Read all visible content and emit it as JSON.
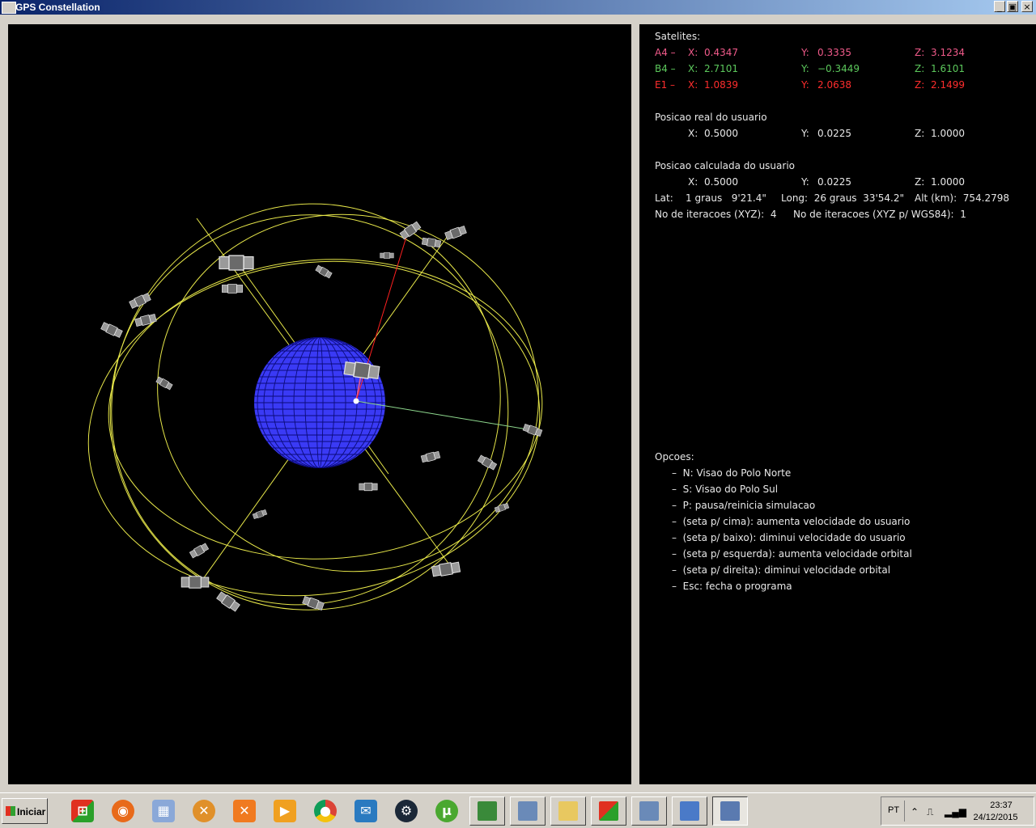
{
  "window": {
    "title": "GPS Constellation",
    "minimize": "_",
    "maximize": "▣",
    "close": "×"
  },
  "info": {
    "satellites_heading": "Satelites:",
    "satellites": [
      {
        "label": "A4 –",
        "x_label": "X:",
        "x": "0.4347",
        "y_label": "Y:",
        "y": "0.3335",
        "z_label": "Z:",
        "z": "3.1234",
        "color": "#f05a8a"
      },
      {
        "label": "B4 –",
        "x_label": "X:",
        "x": "2.7101",
        "y_label": "Y:",
        "y": "−0.3449",
        "z_label": "Z:",
        "z": "1.6101",
        "color": "#5cc85c"
      },
      {
        "label": "E1 –",
        "x_label": "X:",
        "x": "1.0839",
        "y_label": "Y:",
        "y": "2.0638",
        "z_label": "Z:",
        "z": "2.1499",
        "color": "#ff2d2d"
      }
    ],
    "real_heading": "Posicao real do usuario",
    "real": {
      "x_label": "X:",
      "x": "0.5000",
      "y_label": "Y:",
      "y": "0.0225",
      "z_label": "Z:",
      "z": "1.0000"
    },
    "calc_heading": "Posicao calculada do usuario",
    "calc": {
      "x_label": "X:",
      "x": "0.5000",
      "y_label": "Y:",
      "y": "0.0225",
      "z_label": "Z:",
      "z": "1.0000"
    },
    "lat": "Lat:    1 graus   9'21.4\"",
    "long": "Long:  26 graus  33'54.2\"",
    "alt": "Alt (km):  754.2798",
    "iter_xyz": "No de iteracoes (XYZ):  4",
    "iter_wgs": "No de iteracoes (XYZ p/ WGS84):  1",
    "options_heading": "Opcoes:",
    "options": [
      "–  N: Visao do Polo Norte",
      "–  S: Visao do Polo Sul",
      "–  P: pausa/reinicia simulacao",
      "–  (seta p/ cima): aumenta velocidade do usuario",
      "–  (seta p/ baixo): diminui velocidade do usuario",
      "–  (seta p/ esquerda): aumenta velocidade orbital",
      "–  (seta p/ direita): diminui velocidade orbital",
      "–  Esc: fecha o programa"
    ]
  },
  "scene": {
    "earth_color": "#3a3af5",
    "orbit_color": "#e8e84a",
    "link_a4_color": "#f05a8a",
    "link_b4_color": "#8ed88e",
    "link_e1_color": "#ff2020"
  },
  "taskbar": {
    "start_label": "Iniciar",
    "quicklaunch": [
      "windows-icon",
      "firefox-icon",
      "calculator-icon",
      "network-icon",
      "xampp-icon",
      "media-player-icon",
      "chrome-icon",
      "outlook-icon",
      "steam-icon",
      "utorrent-icon",
      "spreadsheet-icon",
      "document-icon",
      "folder-icon"
    ],
    "tasks": [
      "windows-icon",
      "document-icon",
      "control-panel-icon",
      "gps-window-icon"
    ],
    "lang": "PT",
    "time": "23:37",
    "date": "24/12/2015"
  }
}
